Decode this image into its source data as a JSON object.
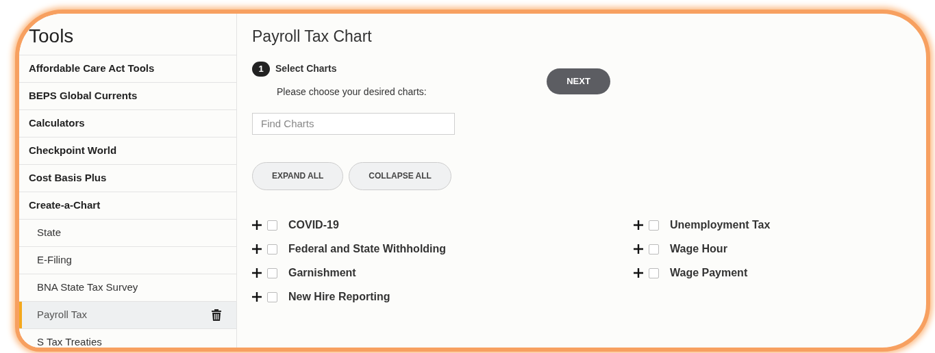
{
  "sidebar": {
    "title": "Tools",
    "items": [
      {
        "label": "Affordable Care Act Tools",
        "selected": false
      },
      {
        "label": "BEPS Global Currents",
        "selected": false
      },
      {
        "label": "Calculators",
        "selected": false
      },
      {
        "label": "Checkpoint World",
        "selected": false
      },
      {
        "label": "Cost Basis Plus",
        "selected": false
      },
      {
        "label": "Create-a-Chart",
        "selected": false,
        "children": [
          {
            "label": "State",
            "selected": false
          },
          {
            "label": "E-Filing",
            "selected": false
          },
          {
            "label": "BNA State Tax Survey",
            "selected": false
          },
          {
            "label": "Payroll Tax",
            "selected": true
          },
          {
            "label": "S Tax Treaties",
            "selected": false
          }
        ]
      }
    ]
  },
  "main": {
    "title": "Payroll Tax Chart",
    "step": {
      "number": "1",
      "label": "Select Charts",
      "instruction": "Please choose your desired charts:"
    },
    "next_button": "NEXT",
    "search": {
      "placeholder": "Find Charts"
    },
    "buttons": [
      "EXPAND ALL",
      "COLLAPSE ALL"
    ],
    "chart_columns": [
      [
        {
          "label": "COVID-19",
          "expanded": false,
          "checked": false
        },
        {
          "label": "Federal and State Withholding",
          "expanded": false,
          "checked": false
        },
        {
          "label": "Garnishment",
          "expanded": false,
          "checked": false
        },
        {
          "label": "New Hire Reporting",
          "expanded": false,
          "checked": false
        }
      ],
      [
        {
          "label": "Unemployment Tax",
          "expanded": false,
          "checked": false
        },
        {
          "label": "Wage Hour",
          "expanded": false,
          "checked": false
        },
        {
          "label": "Wage Payment",
          "expanded": false,
          "checked": false
        }
      ]
    ]
  }
}
